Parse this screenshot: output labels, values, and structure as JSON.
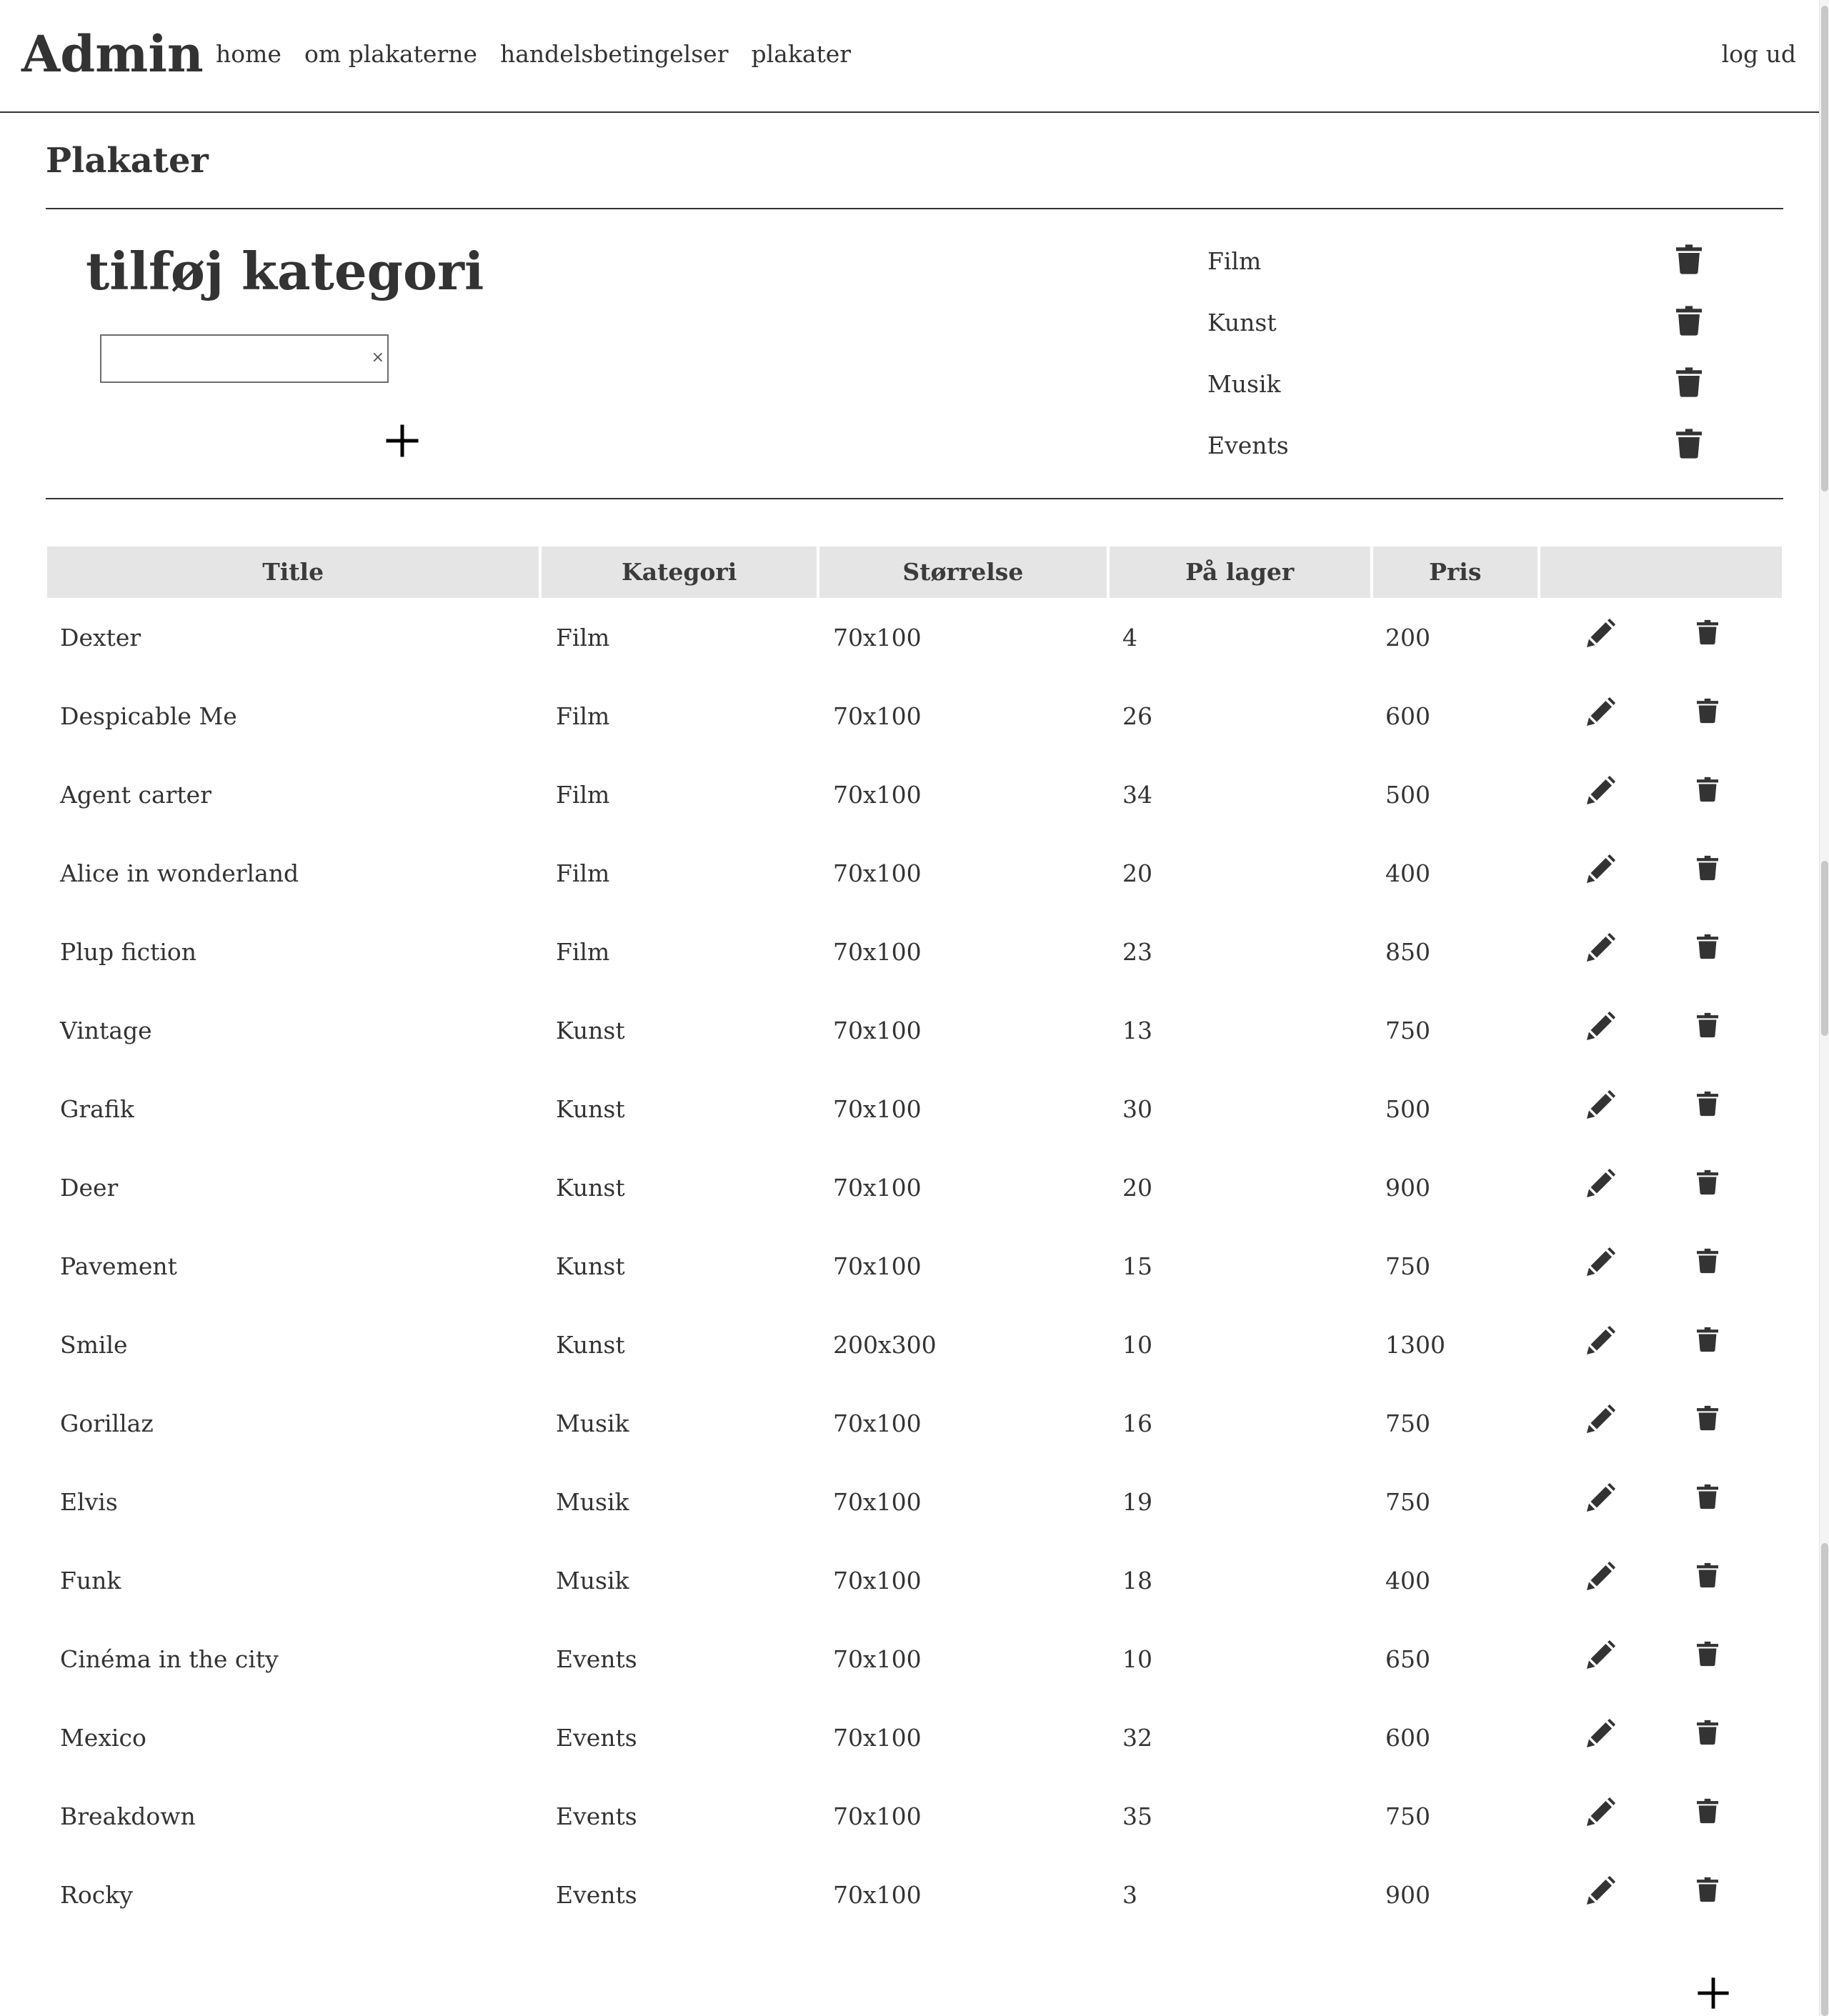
{
  "header": {
    "brand": "Admin",
    "nav": [
      "home",
      "om plakaterne",
      "handelsbetingelser",
      "plakater"
    ],
    "logout": "log ud"
  },
  "page_title": "Plakater",
  "add_category": {
    "title": "tilføj kategori",
    "input_value": "",
    "clear_icon": "×",
    "add_icon": "plus-icon"
  },
  "categories": [
    "Film",
    "Kunst",
    "Musik",
    "Events"
  ],
  "table": {
    "columns": [
      "Title",
      "Kategori",
      "Størrelse",
      "På lager",
      "Pris",
      ""
    ],
    "rows": [
      {
        "title": "Dexter",
        "kategori": "Film",
        "stoerrelse": "70x100",
        "paa_lager": "4",
        "pris": "200"
      },
      {
        "title": "Despicable Me",
        "kategori": "Film",
        "stoerrelse": "70x100",
        "paa_lager": "26",
        "pris": "600"
      },
      {
        "title": "Agent carter",
        "kategori": "Film",
        "stoerrelse": "70x100",
        "paa_lager": "34",
        "pris": "500"
      },
      {
        "title": "Alice in wonderland",
        "kategori": "Film",
        "stoerrelse": "70x100",
        "paa_lager": "20",
        "pris": "400"
      },
      {
        "title": "Plup fiction",
        "kategori": "Film",
        "stoerrelse": "70x100",
        "paa_lager": "23",
        "pris": "850"
      },
      {
        "title": "Vintage",
        "kategori": "Kunst",
        "stoerrelse": "70x100",
        "paa_lager": "13",
        "pris": "750"
      },
      {
        "title": "Grafik",
        "kategori": "Kunst",
        "stoerrelse": "70x100",
        "paa_lager": "30",
        "pris": "500"
      },
      {
        "title": "Deer",
        "kategori": "Kunst",
        "stoerrelse": "70x100",
        "paa_lager": "20",
        "pris": "900"
      },
      {
        "title": "Pavement",
        "kategori": "Kunst",
        "stoerrelse": "70x100",
        "paa_lager": "15",
        "pris": "750"
      },
      {
        "title": "Smile",
        "kategori": "Kunst",
        "stoerrelse": "200x300",
        "paa_lager": "10",
        "pris": "1300"
      },
      {
        "title": "Gorillaz",
        "kategori": "Musik",
        "stoerrelse": "70x100",
        "paa_lager": "16",
        "pris": "750"
      },
      {
        "title": "Elvis",
        "kategori": "Musik",
        "stoerrelse": "70x100",
        "paa_lager": "19",
        "pris": "750"
      },
      {
        "title": "Funk",
        "kategori": "Musik",
        "stoerrelse": "70x100",
        "paa_lager": "18",
        "pris": "400"
      },
      {
        "title": "Cinéma in the city",
        "kategori": "Events",
        "stoerrelse": "70x100",
        "paa_lager": "10",
        "pris": "650"
      },
      {
        "title": "Mexico",
        "kategori": "Events",
        "stoerrelse": "70x100",
        "paa_lager": "32",
        "pris": "600"
      },
      {
        "title": "Breakdown",
        "kategori": "Events",
        "stoerrelse": "70x100",
        "paa_lager": "35",
        "pris": "750"
      },
      {
        "title": "Rocky",
        "kategori": "Events",
        "stoerrelse": "70x100",
        "paa_lager": "3",
        "pris": "900"
      }
    ],
    "row_icons": [
      "pencil-icon",
      "trash-icon"
    ],
    "add_icon": "plus-icon"
  },
  "colors": {
    "text": "#333333",
    "header_bg": "#e5e5e5",
    "rule": "#333333"
  }
}
